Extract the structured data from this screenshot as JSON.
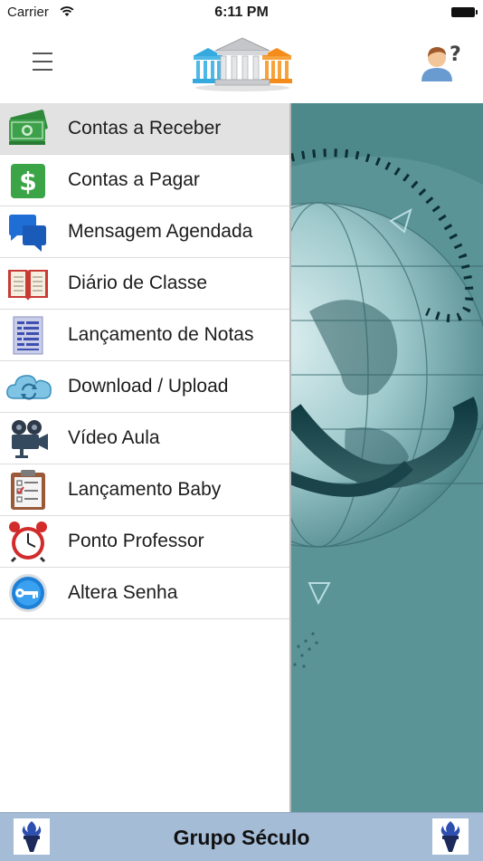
{
  "status_bar": {
    "carrier": "Carrier",
    "time": "6:11 PM"
  },
  "header": {
    "menu_icon": "hamburger-icon",
    "logo_icon": "bank-columns-logo",
    "help_icon": "user-question-icon"
  },
  "menu": {
    "items": [
      {
        "label": "Contas a Receber",
        "icon": "money-icon",
        "active": true
      },
      {
        "label": "Contas a Pagar",
        "icon": "dollar-sign-icon"
      },
      {
        "label": "Mensagem Agendada",
        "icon": "chat-bubbles-icon"
      },
      {
        "label": "Diário de Classe",
        "icon": "open-book-icon"
      },
      {
        "label": "Lançamento de Notas",
        "icon": "document-lines-icon"
      },
      {
        "label": "Download / Upload",
        "icon": "cloud-sync-icon"
      },
      {
        "label": "Vídeo Aula",
        "icon": "movie-camera-icon"
      },
      {
        "label": "Lançamento Baby",
        "icon": "clipboard-checklist-icon"
      },
      {
        "label": "Ponto Professor",
        "icon": "alarm-clock-icon"
      },
      {
        "label": "Altera Senha",
        "icon": "key-icon"
      }
    ]
  },
  "footer": {
    "title": "Grupo Século",
    "icon": "torch-icon"
  },
  "colors": {
    "footer_bg": "#a5bcd7",
    "active_row": "#e2e2e2",
    "scene_teal": "#5a9497"
  }
}
